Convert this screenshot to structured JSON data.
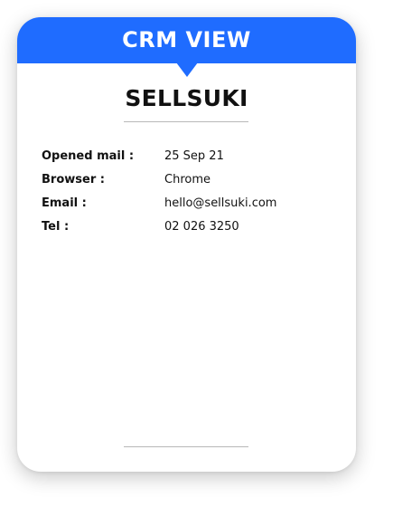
{
  "header": {
    "title": "CRM VIEW"
  },
  "brand": {
    "name": "SELLSUKI"
  },
  "details": [
    {
      "label": "Opened mail :",
      "value": "25 Sep 21"
    },
    {
      "label": "Browser :",
      "value": "Chrome"
    },
    {
      "label": "Email :",
      "value": "hello@sellsuki.com"
    },
    {
      "label": "Tel :",
      "value": "02 026 3250"
    }
  ],
  "colors": {
    "header": "#1f6cff",
    "card": "#ffffff",
    "text": "#111111",
    "divider": "#b8b8b8"
  }
}
